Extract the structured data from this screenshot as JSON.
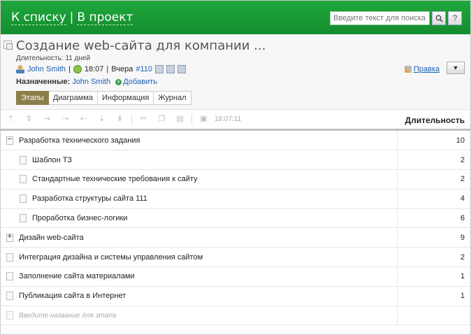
{
  "nav": {
    "back": "К списку",
    "separator": "|",
    "project": "В проект"
  },
  "search": {
    "placeholder": "Введите текст для поиска",
    "go_icon": "search-icon",
    "help_label": "?"
  },
  "project": {
    "title": "Создание web-сайта для компании ...",
    "duration_text": "Длительность: 11 дней",
    "author": "John Smith",
    "separator": "|",
    "time": "18:07",
    "day": "Вчера",
    "number": "#110",
    "assigned_label": "Назначенные:",
    "assigned_user": "John Smith",
    "add_label": "Добавить",
    "edit_label": "Правка",
    "menu_icon": "▼"
  },
  "tabs": [
    {
      "label": "Этапы",
      "active": true
    },
    {
      "label": "Диаграмма",
      "active": false
    },
    {
      "label": "Информация",
      "active": false
    },
    {
      "label": "Журнал",
      "active": false
    }
  ],
  "toolbar": {
    "time": "18:07:11",
    "column_header": "Длительность"
  },
  "rows": [
    {
      "name": "Разработка технического задания",
      "duration": "10",
      "level": 0,
      "toggle": "minus"
    },
    {
      "name": "Шаблон ТЗ",
      "duration": "2",
      "level": 1,
      "toggle": ""
    },
    {
      "name": "Стандартные технические требования к сайту",
      "duration": "2",
      "level": 1,
      "toggle": ""
    },
    {
      "name": "Разработка структуры сайта 111",
      "duration": "4",
      "level": 1,
      "toggle": ""
    },
    {
      "name": "Проработка бизнес-логики",
      "duration": "6",
      "level": 1,
      "toggle": ""
    },
    {
      "name": "Дизайн web-сайта",
      "duration": "9",
      "level": 0,
      "toggle": "plus"
    },
    {
      "name": "Интеграция дизайна и системы управления сайтом",
      "duration": "2",
      "level": 0,
      "toggle": ""
    },
    {
      "name": "Заполнение сайта материалами",
      "duration": "1",
      "level": 0,
      "toggle": ""
    },
    {
      "name": "Публикация сайта в Интернет",
      "duration": "1",
      "level": 0,
      "toggle": ""
    }
  ],
  "new_row": {
    "placeholder": "Введите название для этапа"
  }
}
